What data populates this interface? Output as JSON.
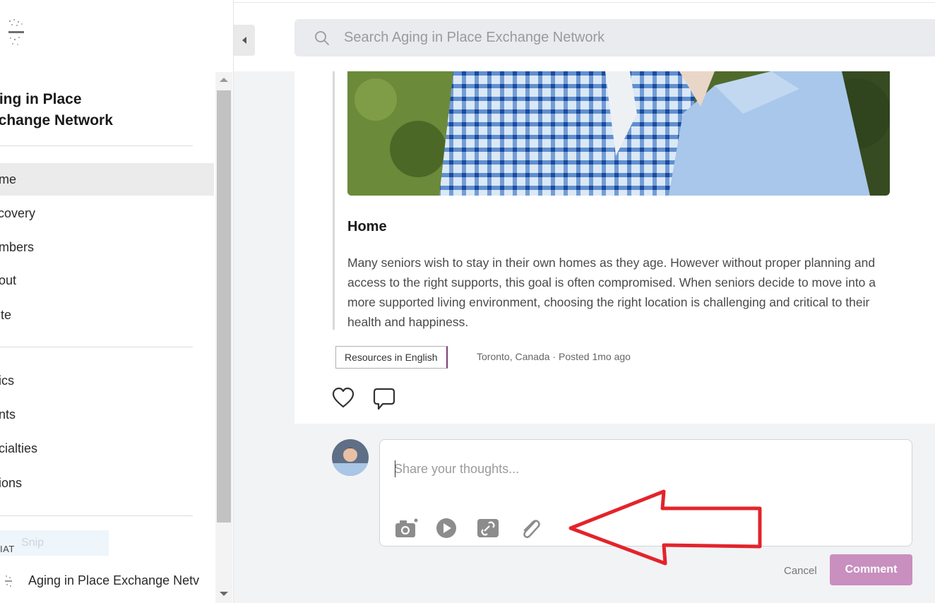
{
  "sidebar": {
    "network_name": "ging in Place xchange Network",
    "nav_primary": [
      {
        "label": "ome",
        "active": true
      },
      {
        "label": "scovery",
        "active": false
      },
      {
        "label": "embers",
        "active": false
      },
      {
        "label": "oout",
        "active": false
      },
      {
        "label": "vite",
        "active": false
      }
    ],
    "nav_secondary": [
      {
        "label": "pics"
      },
      {
        "label": "ents"
      },
      {
        "label": "ecialties"
      },
      {
        "label": "gions"
      }
    ],
    "snip_label": "Snip",
    "chat_heading": "IAT",
    "chat_item": "Aging in Place Exchange Netv"
  },
  "search": {
    "placeholder": "Search Aging in Place Exchange Network"
  },
  "post": {
    "title": "Home",
    "body": "Many seniors wish to stay in their own homes as they age. However without proper planning and access to the right supports, this goal is often compromised. When seniors decide to move into a more supported living environment, choosing the right location is challenging and critical to their health and happiness.",
    "tag": "Resources in English",
    "location": "Toronto, Canada",
    "posted": "Posted 1mo ago"
  },
  "composer": {
    "placeholder": "Share your thoughts...",
    "cancel_label": "Cancel",
    "submit_label": "Comment",
    "tools": [
      "camera-icon",
      "video-icon",
      "link-icon",
      "paperclip-icon"
    ]
  },
  "colors": {
    "accent": "#c88fbf",
    "annotation_arrow": "#e3242b",
    "tag_border": "#7a3f73"
  }
}
